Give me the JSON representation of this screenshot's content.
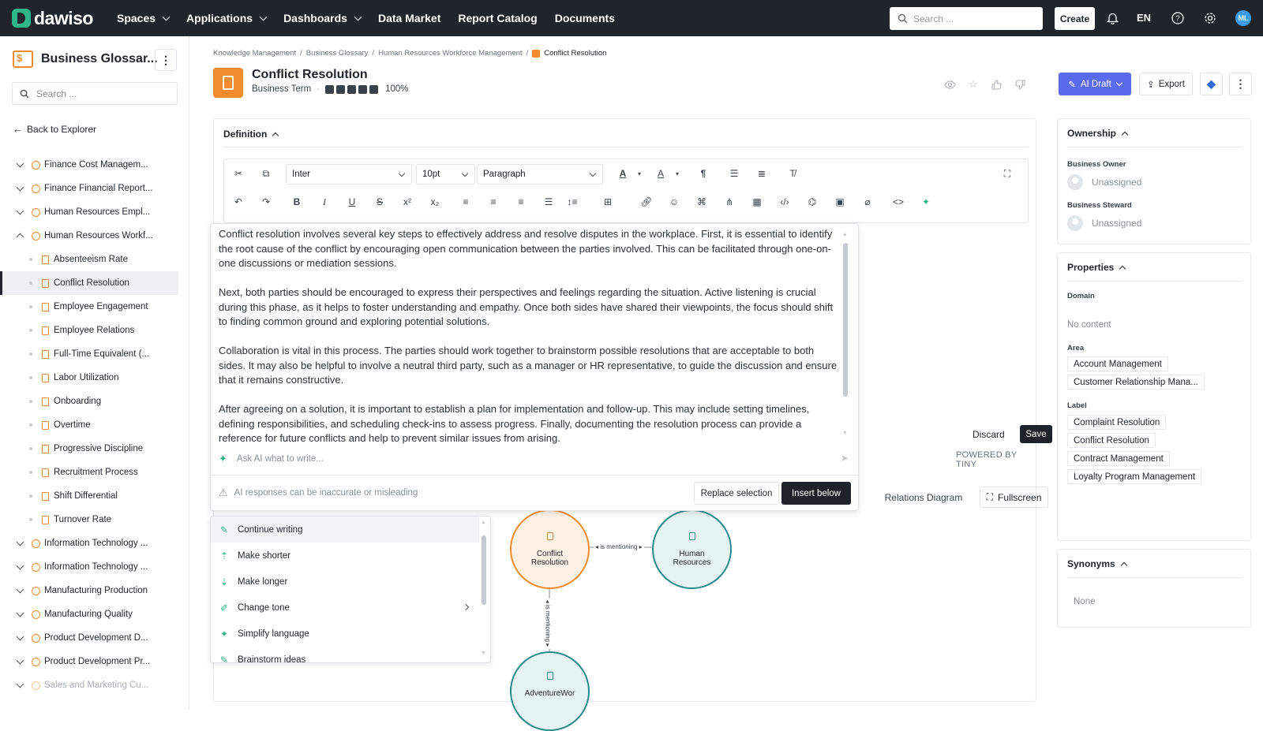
{
  "topbar": {
    "logo": "dawiso",
    "nav": [
      {
        "label": "Spaces",
        "dropdown": true
      },
      {
        "label": "Applications",
        "dropdown": true
      },
      {
        "label": "Dashboards",
        "dropdown": true
      },
      {
        "label": "Data Market",
        "dropdown": false
      },
      {
        "label": "Report Catalog",
        "dropdown": false
      },
      {
        "label": "Documents",
        "dropdown": false
      }
    ],
    "search_placeholder": "Search ...",
    "create_label": "Create",
    "language": "EN",
    "avatar_initials": "ML"
  },
  "sidebar": {
    "title": "Business Glossar...",
    "search_placeholder": "Search ...",
    "back_label": "Back to Explorer",
    "items": [
      {
        "label": "Finance Cost Managem...",
        "type": "group",
        "expanded": false
      },
      {
        "label": "Finance Financial Report...",
        "type": "group",
        "expanded": false
      },
      {
        "label": "Human Resources Empl...",
        "type": "group",
        "expanded": false
      },
      {
        "label": "Human Resources Workf...",
        "type": "group",
        "expanded": true
      },
      {
        "label": "Absenteeism Rate",
        "type": "child"
      },
      {
        "label": "Conflict Resolution",
        "type": "child",
        "active": true
      },
      {
        "label": "Employee Engagement",
        "type": "child"
      },
      {
        "label": "Employee Relations",
        "type": "child"
      },
      {
        "label": "Full-Time Equivalent (...",
        "type": "child"
      },
      {
        "label": "Labor Utilization",
        "type": "child"
      },
      {
        "label": "Onboarding",
        "type": "child"
      },
      {
        "label": "Overtime",
        "type": "child"
      },
      {
        "label": "Progressive Discipline",
        "type": "child"
      },
      {
        "label": "Recruitment Process",
        "type": "child"
      },
      {
        "label": "Shift Differential",
        "type": "child"
      },
      {
        "label": "Turnover Rate",
        "type": "child"
      },
      {
        "label": "Information Technology ...",
        "type": "group",
        "expanded": false
      },
      {
        "label": "Information Technology ...",
        "type": "group",
        "expanded": false
      },
      {
        "label": "Manufacturing Production",
        "type": "group",
        "expanded": false
      },
      {
        "label": "Manufacturing Quality",
        "type": "group",
        "expanded": false
      },
      {
        "label": "Product Development D...",
        "type": "group",
        "expanded": false
      },
      {
        "label": "Product Development Pr...",
        "type": "group",
        "expanded": false
      },
      {
        "label": "Sales and Marketing Cu...",
        "type": "group",
        "expanded": false,
        "faded": true
      }
    ]
  },
  "breadcrumb": [
    "Knowledge Management",
    "Business Glossary",
    "Human Resources Workforce Management",
    "Conflict Resolution"
  ],
  "page": {
    "title": "Conflict Resolution",
    "type": "Business Term",
    "completeness": "100%",
    "completeness_value": 1.0,
    "ai_draft_label": "AI Draft",
    "export_label": "Export"
  },
  "definition": {
    "heading": "Definition",
    "font": "Inter",
    "size": "10pt",
    "block": "Paragraph",
    "discard_label": "Discard",
    "save_label": "Save",
    "powered": "POWERED BY TINY",
    "relations_label": "Relations Diagram",
    "fullscreen_label": "Fullscreen"
  },
  "ai": {
    "paragraphs": [
      "Conflict resolution involves several key steps to effectively address and resolve disputes in the workplace. First, it is essential to identify the root cause of the conflict by encouraging open communication between the parties involved. This can be facilitated through one-on-one discussions or mediation sessions.",
      "Next, both parties should be encouraged to express their perspectives and feelings regarding the situation. Active listening is crucial during this phase, as it helps to foster understanding and empathy. Once both sides have shared their viewpoints, the focus should shift to finding common ground and exploring potential solutions.",
      "Collaboration is vital in this process. The parties should work together to brainstorm possible resolutions that are acceptable to both sides. It may also be helpful to involve a neutral third party, such as a manager or HR representative, to guide the discussion and ensure that it remains constructive.",
      "After agreeing on a solution, it is important to establish a plan for implementation and follow-up. This may include setting timelines, defining responsibilities, and scheduling check-ins to assess progress. Finally, documenting the resolution process can provide a reference for future conflicts and help to prevent similar issues from arising."
    ],
    "ask_placeholder": "Ask AI what to write...",
    "warning": "AI responses can be inaccurate or misleading",
    "replace_label": "Replace selection",
    "insert_label": "Insert below",
    "menu": [
      "Continue writing",
      "Make shorter",
      "Make longer",
      "Change tone",
      "Simplify language",
      "Brainstorm ideas"
    ]
  },
  "diagram": {
    "nodes": [
      "Conflict Resolution",
      "Human Resources",
      "AdventureWor"
    ],
    "edge_label": "is mentioning"
  },
  "ownership": {
    "heading": "Ownership",
    "owner_label": "Business Owner",
    "owner_value": "Unassigned",
    "steward_label": "Business Steward",
    "steward_value": "Unassigned"
  },
  "properties": {
    "heading": "Properties",
    "domain_label": "Domain",
    "domain_value": "No content",
    "area_label": "Area",
    "areas": [
      "Account Management",
      "Customer Relationship Mana..."
    ],
    "label_label": "Label",
    "labels": [
      "Complaint Resolution",
      "Conflict Resolution",
      "Contract Management",
      "Loyalty Program Management"
    ]
  },
  "synonyms": {
    "heading": "Synonyms",
    "value": "None"
  },
  "colors": {
    "brand": "#2fb58a",
    "accent": "#5b6bf0",
    "term": "#f08c2e",
    "node_teal": "#2a8a8a"
  }
}
